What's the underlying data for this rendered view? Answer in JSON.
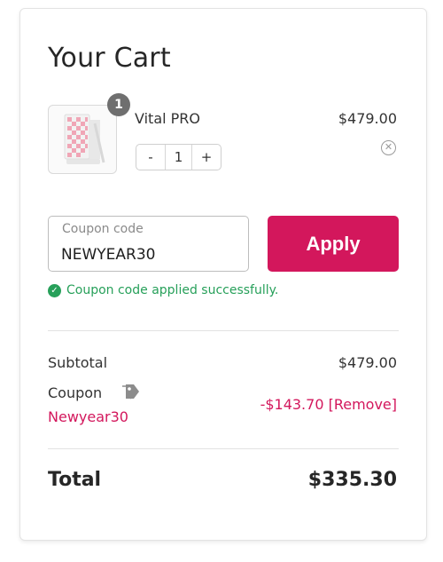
{
  "cart": {
    "title": "Your Cart"
  },
  "item": {
    "name": "Vital PRO",
    "price": "$479.00",
    "quantity": "1",
    "badge_count": "1",
    "decrement_label": "-",
    "increment_label": "+",
    "remove_icon": "close-circle-icon"
  },
  "coupon": {
    "label": "Coupon code",
    "value": "NEWYEAR30",
    "apply_label": "Apply",
    "success_message": "Coupon code applied successfully."
  },
  "summary": {
    "subtotal_label": "Subtotal",
    "subtotal_value": "$479.00",
    "coupon_label": "Coupon",
    "coupon_code": "Newyear30",
    "discount_value": "-$143.70 [Remove]",
    "total_label": "Total",
    "total_value": "$335.30"
  },
  "colors": {
    "accent": "#d3175c",
    "success": "#27a05a"
  }
}
